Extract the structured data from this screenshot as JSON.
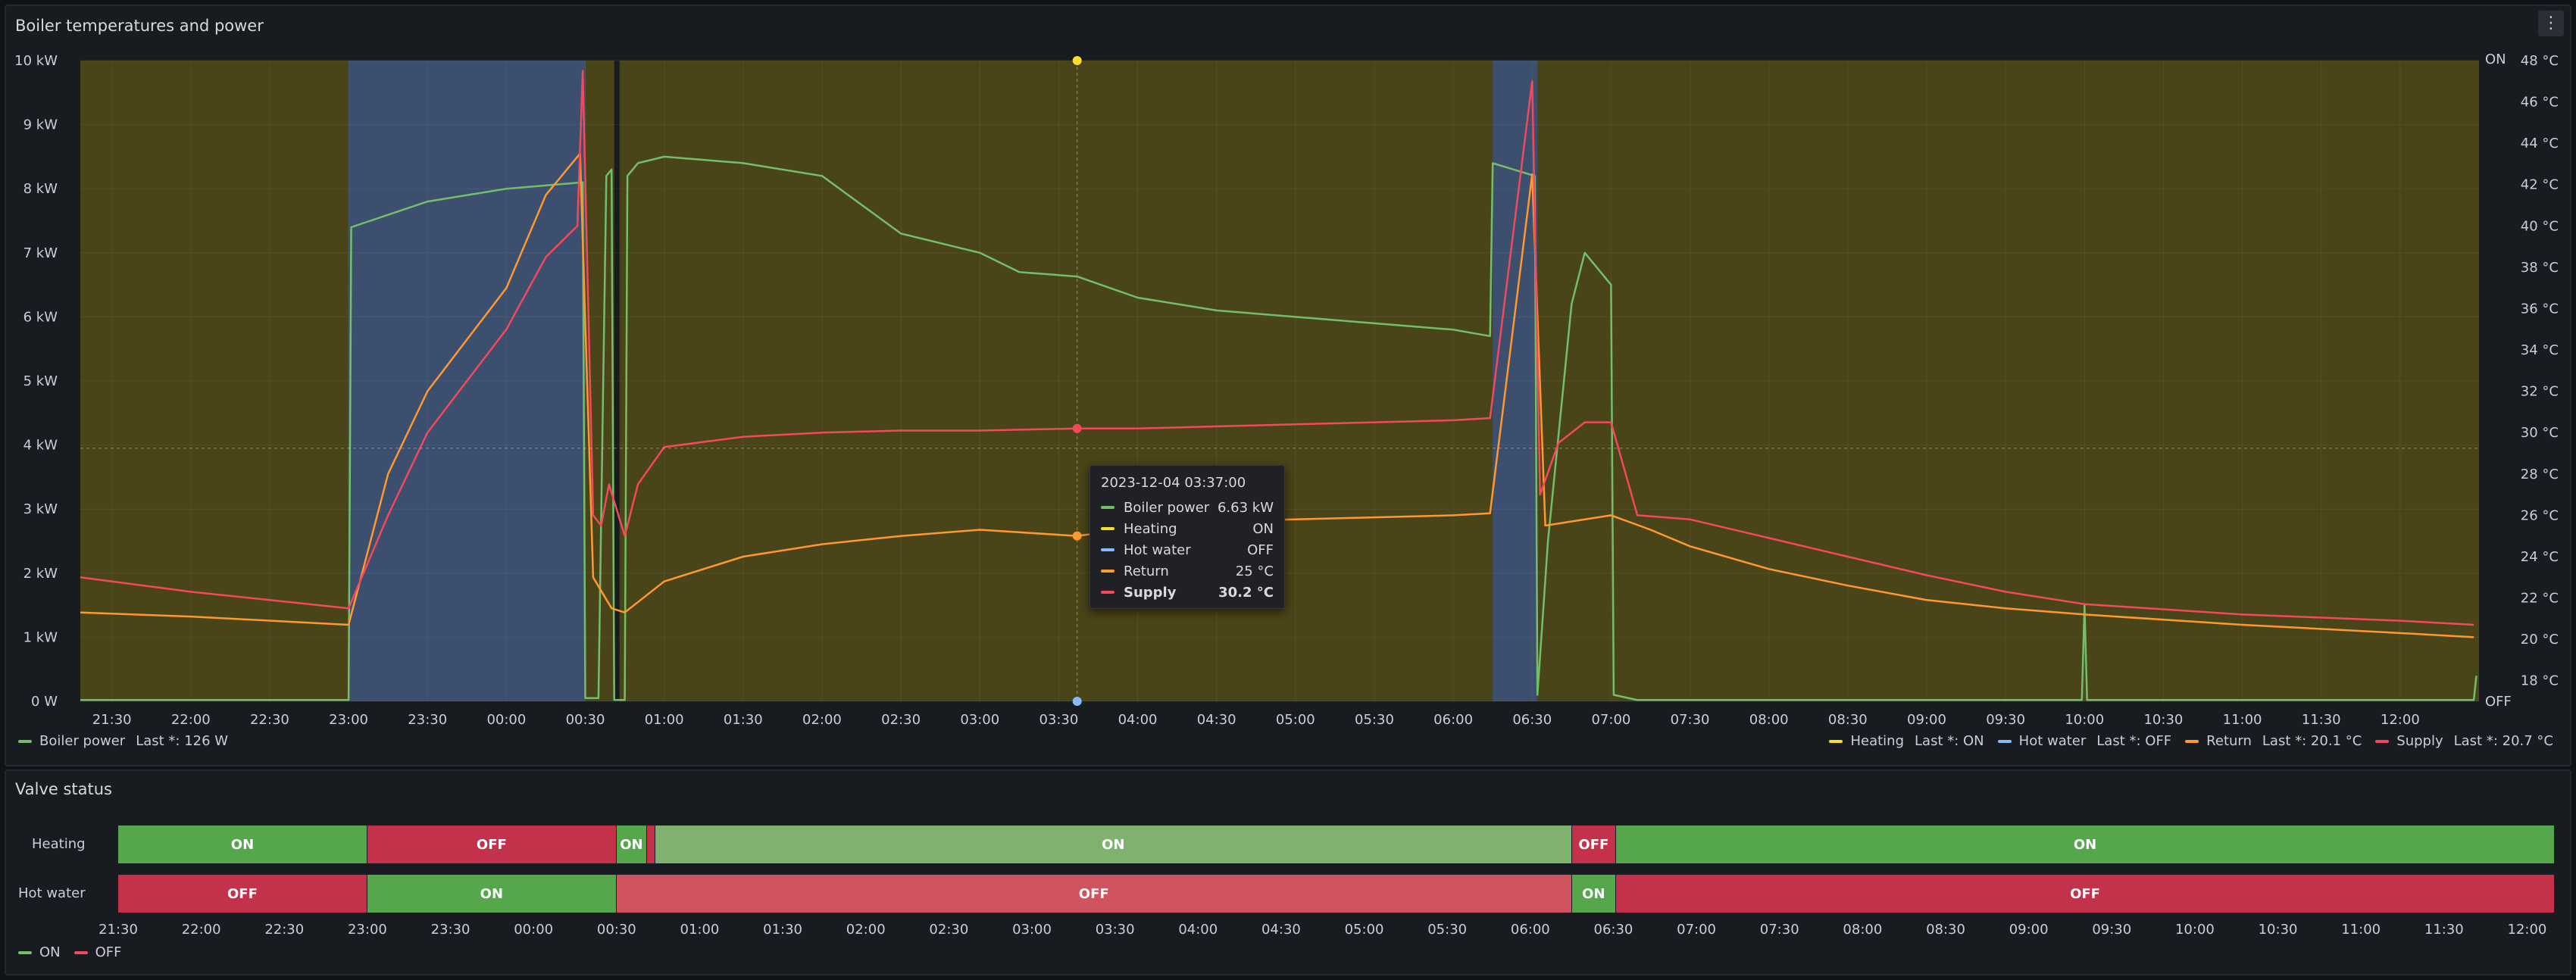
{
  "panel1": {
    "title": "Boiler temperatures and power"
  },
  "panel2": {
    "title": "Valve status"
  },
  "colors": {
    "boiler_power": "#73bf69",
    "heating": "#fade2a",
    "hot_water": "#8ab8ff",
    "return": "#ff9830",
    "supply": "#f2495c",
    "heating_on_bg": "#4a4419",
    "hot_water_on_bg": "#3c4f6f",
    "on_dark": "#56a64b",
    "on_light": "#7fb26e",
    "off_dark": "#c4314b",
    "off_light": "#d0545f"
  },
  "chart_data": {
    "type": "line",
    "x_ticks": [
      "21:30",
      "22:00",
      "22:30",
      "23:00",
      "23:30",
      "00:00",
      "00:30",
      "01:00",
      "01:30",
      "02:00",
      "02:30",
      "03:00",
      "03:30",
      "04:00",
      "04:30",
      "05:00",
      "05:30",
      "06:00",
      "06:30",
      "07:00",
      "07:30",
      "08:00",
      "08:30",
      "09:00",
      "09:30",
      "10:00",
      "10:30",
      "11:00",
      "11:30",
      "12:00"
    ],
    "x_range": [
      "21:18",
      "12:30"
    ],
    "y_left": {
      "ticks": [
        "0 W",
        "1 kW",
        "2 kW",
        "3 kW",
        "4 kW",
        "5 kW",
        "6 kW",
        "7 kW",
        "8 kW",
        "9 kW",
        "10 kW"
      ],
      "ylim": [
        0,
        10
      ]
    },
    "y_right": {
      "ticks": [
        "18 °C",
        "20 °C",
        "22 °C",
        "24 °C",
        "26 °C",
        "28 °C",
        "30 °C",
        "32 °C",
        "34 °C",
        "36 °C",
        "38 °C",
        "40 °C",
        "42 °C",
        "44 °C",
        "46 °C",
        "48 °C"
      ],
      "ylim": [
        17,
        48
      ]
    },
    "state_axis": {
      "top": "ON",
      "bottom": "OFF"
    },
    "hot_water_on_periods": [
      [
        "23:00",
        "00:30"
      ],
      [
        "06:15",
        "06:32"
      ]
    ],
    "heating_off_periods": [
      [
        "00:41",
        "00:43"
      ]
    ],
    "cursor_time": "03:37",
    "cursor_y_kw": 3.95,
    "series": [
      {
        "name": "Boiler power",
        "unit": "kW",
        "axis": "left",
        "points": [
          [
            "21:18",
            0.02
          ],
          [
            "23:00",
            0.02
          ],
          [
            "23:01",
            7.4
          ],
          [
            "23:30",
            7.8
          ],
          [
            "00:00",
            8.0
          ],
          [
            "00:29",
            8.1
          ],
          [
            "00:30",
            0.05
          ],
          [
            "00:35",
            0.05
          ],
          [
            "00:36",
            2.8
          ],
          [
            "00:38",
            8.2
          ],
          [
            "00:40",
            8.3
          ],
          [
            "00:41",
            0.02
          ],
          [
            "00:45",
            0.02
          ],
          [
            "00:46",
            8.2
          ],
          [
            "00:50",
            8.4
          ],
          [
            "01:00",
            8.5
          ],
          [
            "01:30",
            8.4
          ],
          [
            "02:00",
            8.2
          ],
          [
            "02:30",
            7.3
          ],
          [
            "03:00",
            7.0
          ],
          [
            "03:15",
            6.7
          ],
          [
            "03:37",
            6.63
          ],
          [
            "04:00",
            6.3
          ],
          [
            "04:30",
            6.1
          ],
          [
            "05:00",
            6.0
          ],
          [
            "05:30",
            5.9
          ],
          [
            "06:00",
            5.8
          ],
          [
            "06:14",
            5.7
          ],
          [
            "06:15",
            8.4
          ],
          [
            "06:31",
            8.2
          ],
          [
            "06:32",
            0.1
          ],
          [
            "06:36",
            2.5
          ],
          [
            "06:45",
            6.2
          ],
          [
            "06:50",
            7.0
          ],
          [
            "07:00",
            6.5
          ],
          [
            "07:01",
            0.1
          ],
          [
            "07:10",
            0.02
          ],
          [
            "09:59",
            0.02
          ],
          [
            "10:00",
            1.5
          ],
          [
            "10:01",
            0.02
          ],
          [
            "12:28",
            0.02
          ],
          [
            "12:29",
            0.4
          ]
        ]
      },
      {
        "name": "Return",
        "unit": "°C",
        "axis": "right",
        "points": [
          [
            "21:18",
            21.3
          ],
          [
            "22:00",
            21.1
          ],
          [
            "23:00",
            20.7
          ],
          [
            "23:15",
            28
          ],
          [
            "23:30",
            32
          ],
          [
            "00:00",
            37
          ],
          [
            "00:15",
            41.5
          ],
          [
            "00:28",
            43.5
          ],
          [
            "00:33",
            23
          ],
          [
            "00:40",
            21.5
          ],
          [
            "00:45",
            21.3
          ],
          [
            "01:00",
            22.8
          ],
          [
            "01:30",
            24.0
          ],
          [
            "02:00",
            24.6
          ],
          [
            "02:30",
            25.0
          ],
          [
            "03:00",
            25.3
          ],
          [
            "03:37",
            25.0
          ],
          [
            "04:00",
            25.4
          ],
          [
            "04:30",
            25.7
          ],
          [
            "05:00",
            25.8
          ],
          [
            "05:30",
            25.9
          ],
          [
            "06:00",
            26.0
          ],
          [
            "06:14",
            26.1
          ],
          [
            "06:30",
            42.5
          ],
          [
            "06:35",
            25.5
          ],
          [
            "07:00",
            26.0
          ],
          [
            "07:15",
            25.3
          ],
          [
            "07:30",
            24.5
          ],
          [
            "08:00",
            23.4
          ],
          [
            "08:30",
            22.6
          ],
          [
            "09:00",
            21.9
          ],
          [
            "09:30",
            21.5
          ],
          [
            "10:00",
            21.2
          ],
          [
            "11:00",
            20.7
          ],
          [
            "12:00",
            20.3
          ],
          [
            "12:28",
            20.1
          ]
        ]
      },
      {
        "name": "Supply",
        "unit": "°C",
        "axis": "right",
        "points": [
          [
            "21:18",
            23.0
          ],
          [
            "22:00",
            22.3
          ],
          [
            "23:00",
            21.5
          ],
          [
            "23:15",
            26
          ],
          [
            "23:30",
            30
          ],
          [
            "00:00",
            35
          ],
          [
            "00:15",
            38.5
          ],
          [
            "00:27",
            40
          ],
          [
            "00:29",
            47.5
          ],
          [
            "00:33",
            26
          ],
          [
            "00:36",
            25.5
          ],
          [
            "00:39",
            27.5
          ],
          [
            "00:45",
            25.0
          ],
          [
            "00:50",
            27.5
          ],
          [
            "01:00",
            29.3
          ],
          [
            "01:30",
            29.8
          ],
          [
            "02:00",
            30.0
          ],
          [
            "02:30",
            30.1
          ],
          [
            "03:00",
            30.1
          ],
          [
            "03:37",
            30.2
          ],
          [
            "04:00",
            30.2
          ],
          [
            "04:30",
            30.3
          ],
          [
            "05:00",
            30.4
          ],
          [
            "05:30",
            30.5
          ],
          [
            "06:00",
            30.6
          ],
          [
            "06:14",
            30.7
          ],
          [
            "06:30",
            47.0
          ],
          [
            "06:33",
            27.0
          ],
          [
            "06:40",
            29.5
          ],
          [
            "06:50",
            30.5
          ],
          [
            "07:00",
            30.5
          ],
          [
            "07:10",
            26.0
          ],
          [
            "07:30",
            25.8
          ],
          [
            "08:00",
            24.9
          ],
          [
            "08:30",
            24.0
          ],
          [
            "09:00",
            23.1
          ],
          [
            "09:30",
            22.3
          ],
          [
            "10:00",
            21.7
          ],
          [
            "11:00",
            21.2
          ],
          [
            "12:00",
            20.9
          ],
          [
            "12:28",
            20.7
          ]
        ]
      }
    ]
  },
  "legend": {
    "boiler_power": {
      "name": "Boiler power",
      "last": "Last *: 126 W"
    },
    "heating": {
      "name": "Heating",
      "last": "Last *: ON"
    },
    "hot_water": {
      "name": "Hot water",
      "last": "Last *: OFF"
    },
    "return": {
      "name": "Return",
      "last": "Last *: 20.1 °C"
    },
    "supply": {
      "name": "Supply",
      "last": "Last *: 20.7 °C"
    }
  },
  "tooltip": {
    "time": "2023-12-04 03:37:00",
    "rows": [
      {
        "name": "Boiler power",
        "value": "6.63 kW"
      },
      {
        "name": "Heating",
        "value": "ON"
      },
      {
        "name": "Hot water",
        "value": "OFF"
      },
      {
        "name": "Return",
        "value": "25 °C"
      },
      {
        "name": "Supply",
        "value": "30.2 °C"
      }
    ]
  },
  "valve": {
    "x_range": [
      "21:30",
      "12:10"
    ],
    "rows": [
      {
        "label": "Heating",
        "segments": [
          {
            "from": "21:30",
            "to": "23:00",
            "state": "ON",
            "tone": "dark"
          },
          {
            "from": "23:00",
            "to": "00:30",
            "state": "OFF",
            "tone": "dark"
          },
          {
            "from": "00:30",
            "to": "00:41",
            "state": "ON",
            "tone": "dark"
          },
          {
            "from": "00:41",
            "to": "00:44",
            "state": "",
            "tone": "dark"
          },
          {
            "from": "00:44",
            "to": "06:15",
            "state": "ON",
            "tone": "light"
          },
          {
            "from": "06:15",
            "to": "06:31",
            "state": "OFF",
            "tone": "dark"
          },
          {
            "from": "06:31",
            "to": "12:10",
            "state": "ON",
            "tone": "dark"
          }
        ]
      },
      {
        "label": "Hot water",
        "segments": [
          {
            "from": "21:30",
            "to": "23:00",
            "state": "OFF",
            "tone": "dark"
          },
          {
            "from": "23:00",
            "to": "00:30",
            "state": "ON",
            "tone": "dark"
          },
          {
            "from": "00:30",
            "to": "06:15",
            "state": "OFF",
            "tone": "light"
          },
          {
            "from": "06:15",
            "to": "06:31",
            "state": "ON",
            "tone": "dark"
          },
          {
            "from": "06:31",
            "to": "12:10",
            "state": "OFF",
            "tone": "dark"
          }
        ]
      }
    ],
    "x_ticks": [
      "21:30",
      "22:00",
      "22:30",
      "23:00",
      "23:30",
      "00:00",
      "00:30",
      "01:00",
      "01:30",
      "02:00",
      "02:30",
      "03:00",
      "03:30",
      "04:00",
      "04:30",
      "05:00",
      "05:30",
      "06:00",
      "06:30",
      "07:00",
      "07:30",
      "08:00",
      "08:30",
      "09:00",
      "09:30",
      "10:00",
      "10:30",
      "11:00",
      "11:30",
      "12:00"
    ],
    "legend": [
      {
        "name": "ON"
      },
      {
        "name": "OFF"
      }
    ]
  }
}
